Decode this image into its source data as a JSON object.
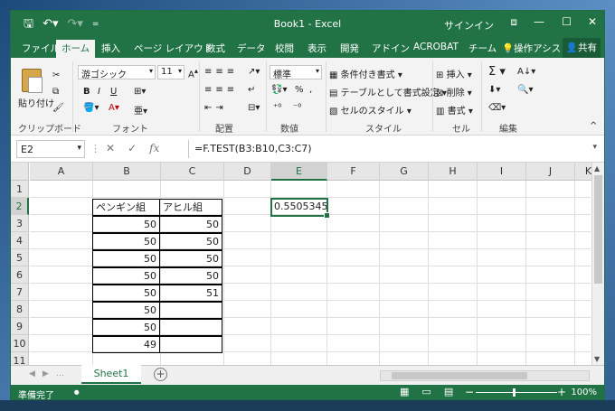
{
  "window": {
    "title": "Book1 - Excel",
    "signin": "サインイン",
    "qat": {
      "save_icon": "save-icon",
      "undo_icon": "undo-icon",
      "redo_icon": "redo-icon"
    },
    "controls": {
      "minimize": "—",
      "restore": "☐",
      "close": "✕",
      "ribbon_options": "⧈"
    }
  },
  "tabs": [
    {
      "label": "ファイル"
    },
    {
      "label": "ホーム",
      "active": true
    },
    {
      "label": "挿入"
    },
    {
      "label": "ページ レイアウト"
    },
    {
      "label": "数式"
    },
    {
      "label": "データ"
    },
    {
      "label": "校閲"
    },
    {
      "label": "表示"
    },
    {
      "label": "開発"
    },
    {
      "label": "アドイン"
    },
    {
      "label": "ACROBAT"
    },
    {
      "label": "チーム"
    },
    {
      "label": "操作アシス"
    }
  ],
  "share_label": "共有",
  "ribbon": {
    "clipboard": {
      "paste": "貼り付け",
      "label": "クリップボード"
    },
    "font": {
      "name": "游ゴシック",
      "size": "11",
      "bold": "B",
      "italic": "I",
      "underline": "U",
      "label": "フォント"
    },
    "alignment": {
      "label": "配置"
    },
    "number": {
      "format": "標準",
      "percent": "%",
      "comma": ",",
      "label": "数値"
    },
    "styles": {
      "conditional": "条件付き書式",
      "table": "テーブルとして書式設定",
      "cell_styles": "セルのスタイル",
      "label": "スタイル"
    },
    "cells": {
      "insert": "挿入",
      "delete": "削除",
      "format": "書式",
      "label": "セル"
    },
    "editing": {
      "sum": "Σ",
      "label": "編集"
    }
  },
  "formula_bar": {
    "name_box": "E2",
    "formula": "=F.TEST(B3:B10,C3:C7)",
    "fx": "fx"
  },
  "columns": [
    "A",
    "B",
    "C",
    "D",
    "E",
    "F",
    "G",
    "H",
    "I",
    "J",
    "K"
  ],
  "rows": [
    "1",
    "2",
    "3",
    "4",
    "5",
    "6",
    "7",
    "8",
    "9",
    "10",
    "11"
  ],
  "selected": {
    "column": "E",
    "row": "2"
  },
  "table": {
    "headers": [
      "ペンギン組",
      "アヒル組"
    ],
    "col_b": [
      "50",
      "50",
      "50",
      "50",
      "50",
      "50",
      "50",
      "49"
    ],
    "col_c": [
      "50",
      "50",
      "50",
      "50",
      "51"
    ]
  },
  "result_cell": "0.5505345",
  "sheet": {
    "tab": "Sheet1",
    "add": "⊕"
  },
  "status": {
    "ready": "準備完了",
    "zoom": "100%",
    "minus": "−",
    "plus": "+"
  }
}
